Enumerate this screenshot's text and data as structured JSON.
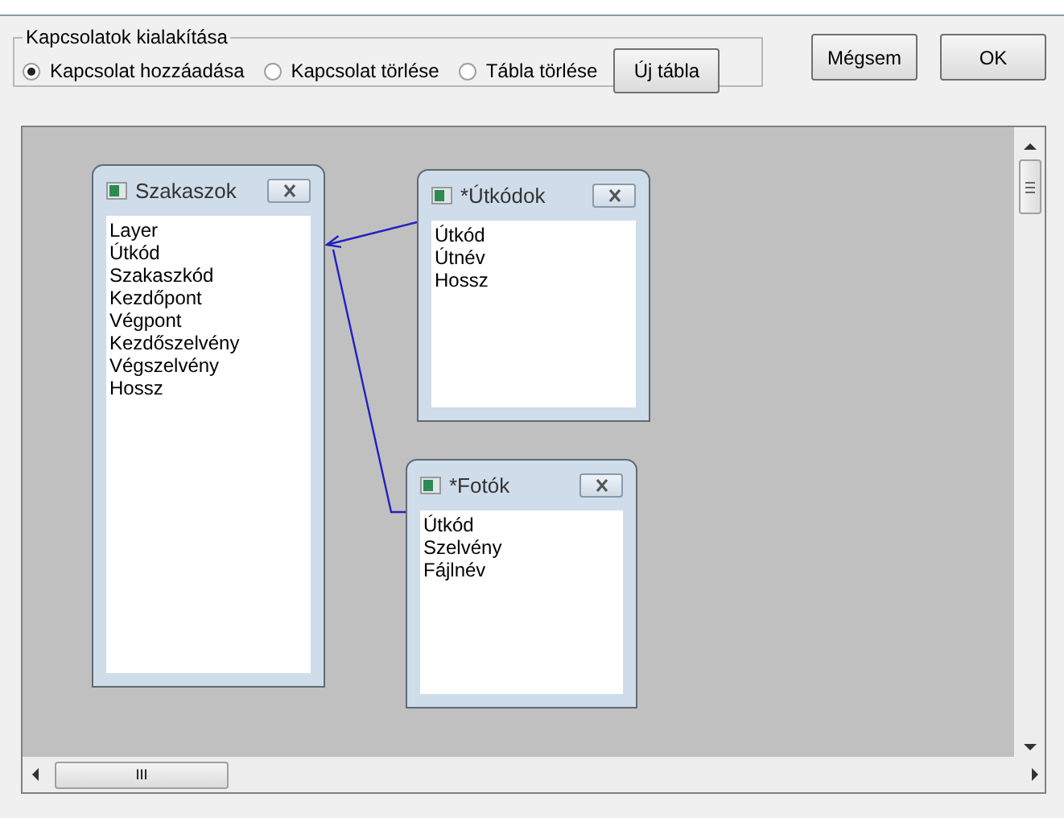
{
  "group": {
    "title": "Kapcsolatok kialakítása",
    "options": [
      {
        "label": "Kapcsolat hozzáadása",
        "selected": true
      },
      {
        "label": "Kapcsolat törlése",
        "selected": false
      },
      {
        "label": "Tábla törlése",
        "selected": false
      }
    ],
    "button": "Új tábla"
  },
  "buttons": [
    "Mégsem",
    "OK"
  ],
  "tables": [
    {
      "title": "Szakaszok",
      "fields": [
        "Layer",
        "Útkód",
        "Szakaszkód",
        "Kezdőpont",
        "Végpont",
        "Kezdőszelvény",
        "Végszelvény",
        "Hossz"
      ]
    },
    {
      "title": "*Útkódok",
      "fields": [
        "Útkód",
        "Útnév",
        "Hossz"
      ]
    },
    {
      "title": "*Fotók",
      "fields": [
        "Útkód",
        "Szelvény",
        "Fájlnév"
      ]
    }
  ],
  "scrollbars": {
    "horizontal_thumb": "III"
  }
}
